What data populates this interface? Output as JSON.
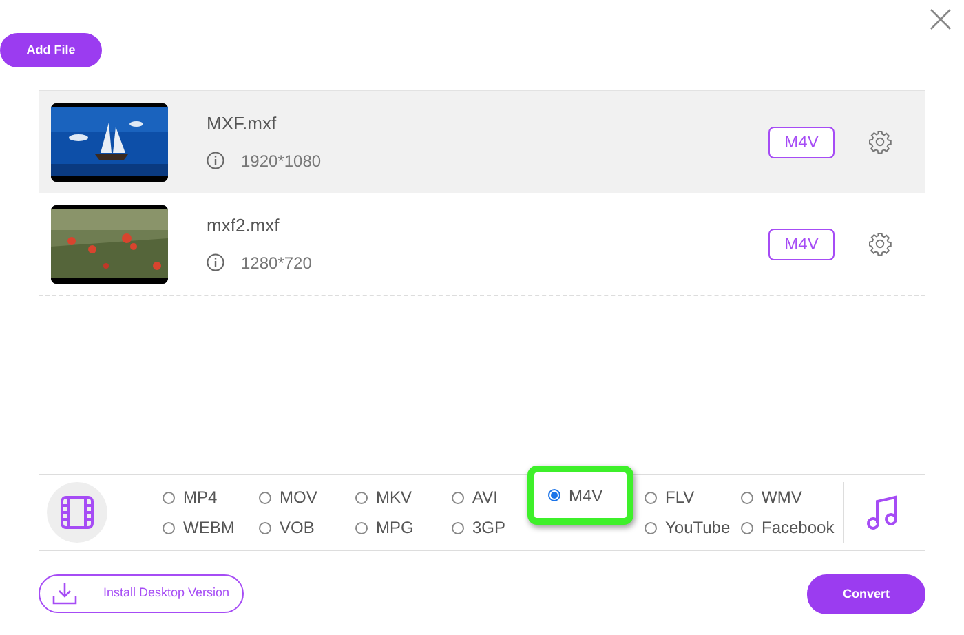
{
  "add_button": "Add File",
  "files": [
    {
      "name": "MXF.mxf",
      "resolution": "1920*1080",
      "format": "M4V",
      "selected": true
    },
    {
      "name": "mxf2.mxf",
      "resolution": "1280*720",
      "format": "M4V",
      "selected": false
    }
  ],
  "formats": [
    {
      "label": "MP4",
      "selected": false
    },
    {
      "label": "WEBM",
      "selected": false
    },
    {
      "label": "MOV",
      "selected": false
    },
    {
      "label": "VOB",
      "selected": false
    },
    {
      "label": "MKV",
      "selected": false
    },
    {
      "label": "MPG",
      "selected": false
    },
    {
      "label": "AVI",
      "selected": false
    },
    {
      "label": "3GP",
      "selected": false
    },
    {
      "label": "M4V",
      "selected": true,
      "highlighted": true
    },
    {
      "label": "FLV",
      "selected": false
    },
    {
      "label": "YouTube",
      "selected": false
    },
    {
      "label": "WMV",
      "selected": false
    },
    {
      "label": "Facebook",
      "selected": false
    }
  ],
  "install_button": "Install Desktop Version",
  "convert_button": "Convert"
}
